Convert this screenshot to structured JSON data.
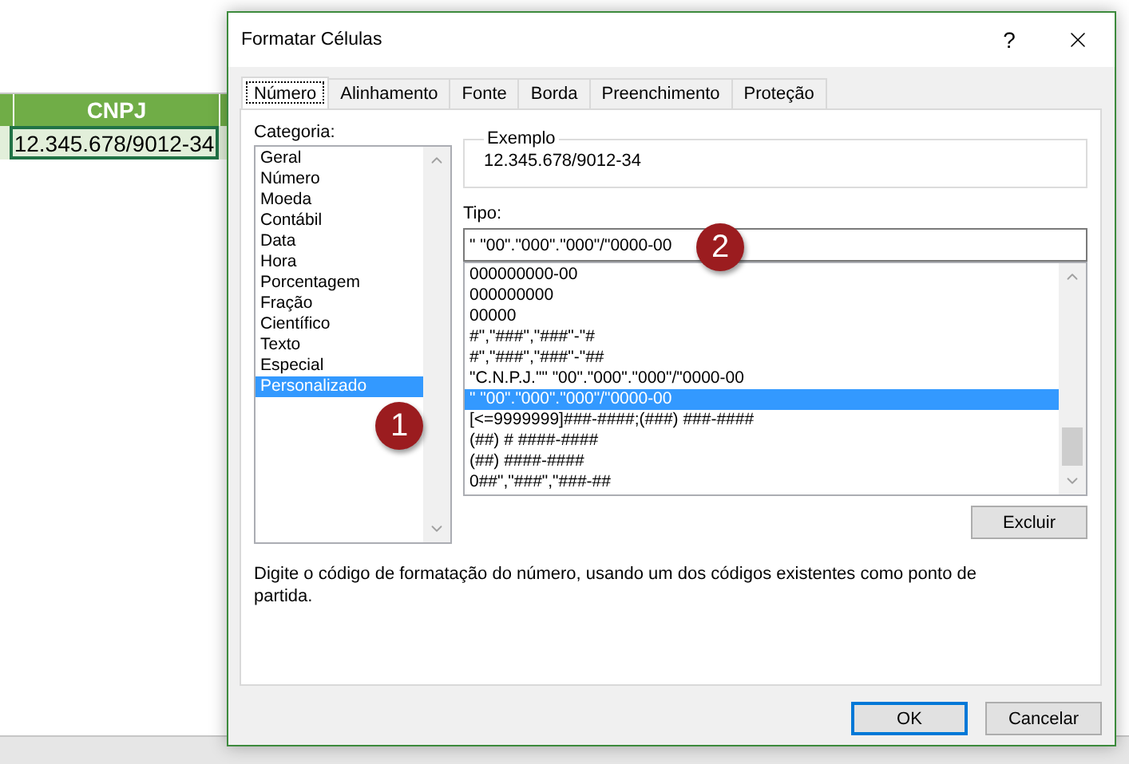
{
  "sheet": {
    "header": "CNPJ",
    "cell": "12.345.678/9012-34"
  },
  "dialog": {
    "title": "Formatar Células",
    "help": "?",
    "tabs": [
      {
        "label": "Número",
        "selected": true
      },
      {
        "label": "Alinhamento",
        "selected": false
      },
      {
        "label": "Fonte",
        "selected": false
      },
      {
        "label": "Borda",
        "selected": false
      },
      {
        "label": "Preenchimento",
        "selected": false
      },
      {
        "label": "Proteção",
        "selected": false
      }
    ],
    "category_label": "Categoria:",
    "categories": [
      {
        "label": "Geral",
        "selected": false
      },
      {
        "label": "Número",
        "selected": false
      },
      {
        "label": "Moeda",
        "selected": false
      },
      {
        "label": "Contábil",
        "selected": false
      },
      {
        "label": "Data",
        "selected": false
      },
      {
        "label": "Hora",
        "selected": false
      },
      {
        "label": "Porcentagem",
        "selected": false
      },
      {
        "label": "Fração",
        "selected": false
      },
      {
        "label": "Científico",
        "selected": false
      },
      {
        "label": "Texto",
        "selected": false
      },
      {
        "label": "Especial",
        "selected": false
      },
      {
        "label": "Personalizado",
        "selected": true
      }
    ],
    "example": {
      "label": "Exemplo",
      "value": "12.345.678/9012-34"
    },
    "type_label": "Tipo:",
    "type_value": "\" \"00\".\"000\".\"000\"/\"0000-00",
    "formats": [
      {
        "label": "000000000-00",
        "selected": false
      },
      {
        "label": "000000000",
        "selected": false
      },
      {
        "label": "00000",
        "selected": false
      },
      {
        "label": "#\",\"###\",\"###\"-\"#",
        "selected": false
      },
      {
        "label": "#\",\"###\",\"###\"-\"##",
        "selected": false
      },
      {
        "label": "\"C.N.P.J.\"\" \"00\".\"000\".\"000\"/\"0000-00",
        "selected": false
      },
      {
        "label": "\" \"00\".\"000\".\"000\"/\"0000-00",
        "selected": true
      },
      {
        "label": "[<=9999999]###-####;(###) ###-####",
        "selected": false
      },
      {
        "label": "(##) # ####-####",
        "selected": false
      },
      {
        "label": "(##) ####-####",
        "selected": false
      },
      {
        "label": "0##\",\"###\",\"###-##",
        "selected": false
      }
    ],
    "delete_button": "Excluir",
    "description": "Digite o código de formatação do número, usando um dos códigos existentes como ponto de partida.",
    "buttons": [
      {
        "label": "OK",
        "default": true
      },
      {
        "label": "Cancelar",
        "default": false
      }
    ]
  },
  "callouts": [
    "1",
    "2"
  ]
}
